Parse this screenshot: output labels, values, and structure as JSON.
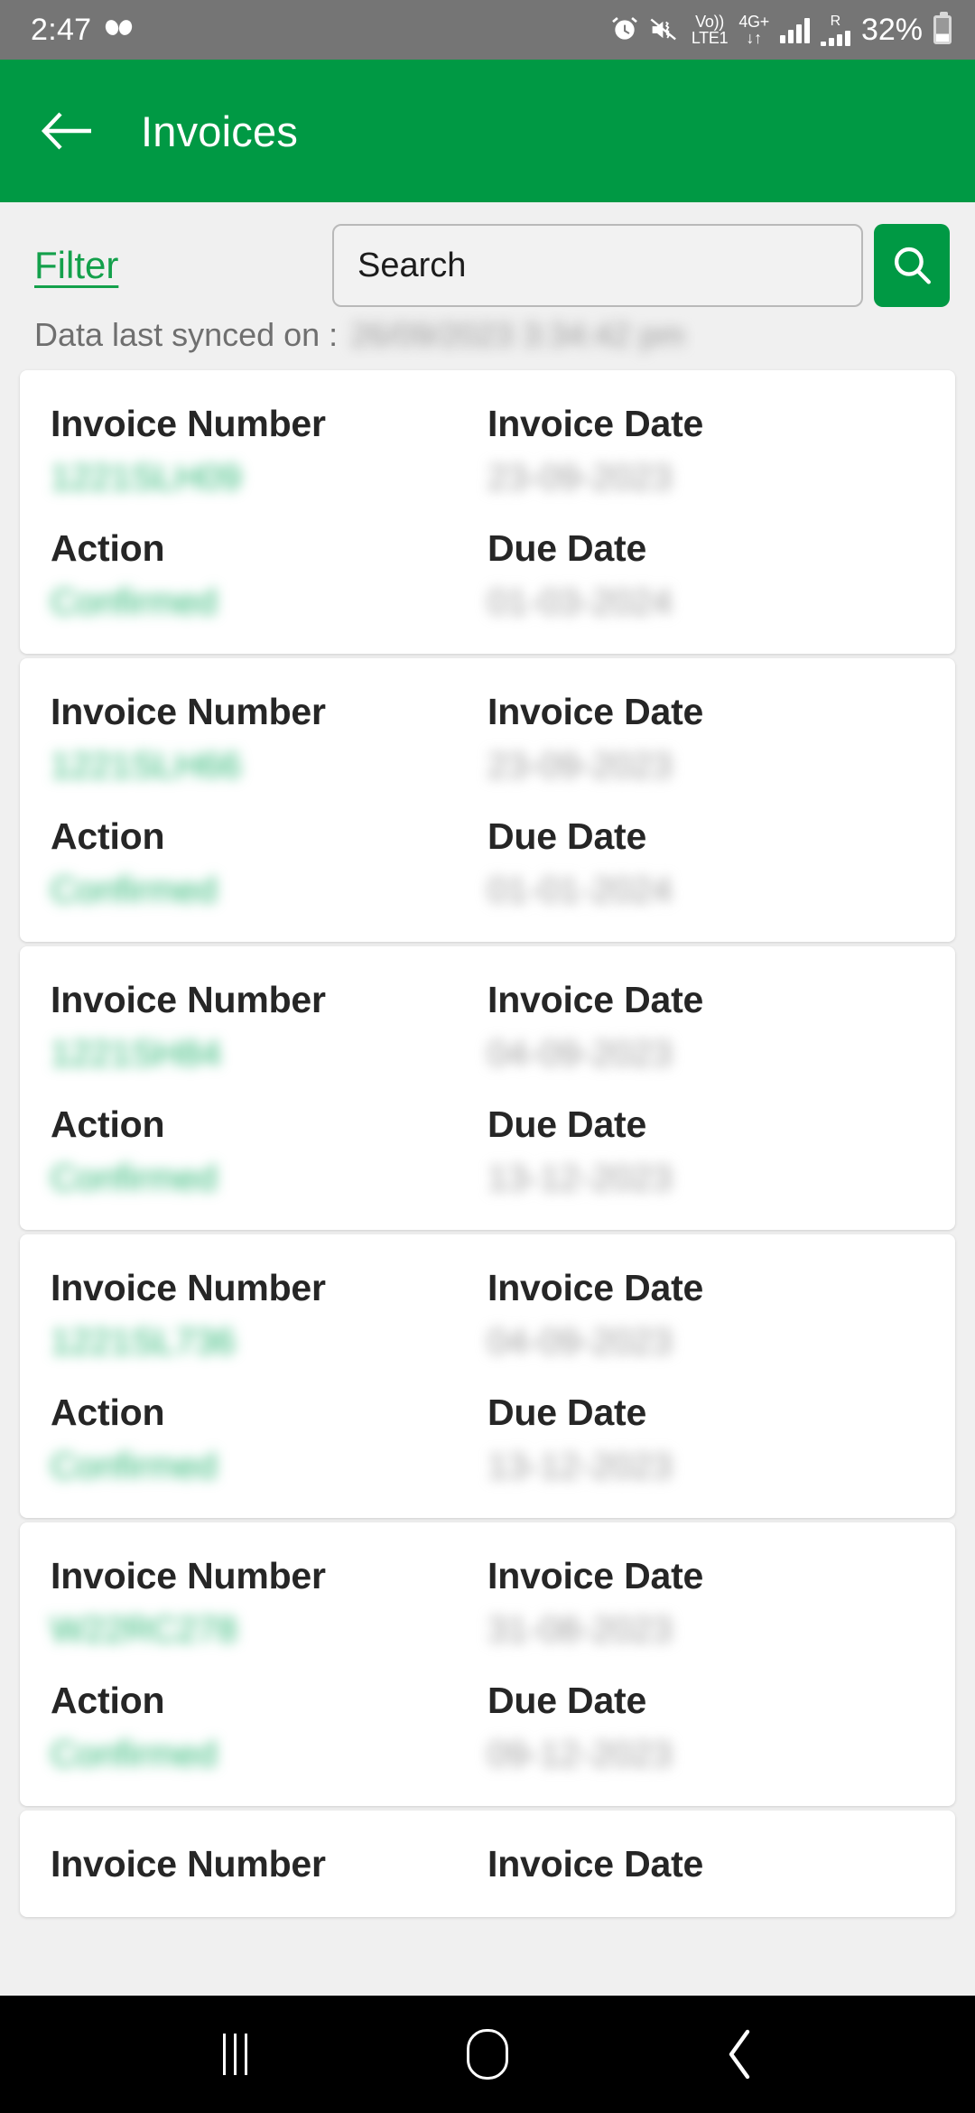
{
  "status_bar": {
    "time": "2:47",
    "app_icon": "clover-icon",
    "icons": [
      "alarm-icon",
      "mute-vibrate-icon",
      "volte-icon",
      "network-4g-plus-icon",
      "signal-bars-icon",
      "roaming-signal-icon"
    ],
    "volte_line1": "Vo))",
    "volte_line2": "LTE1",
    "network_line1": "4G+",
    "network_line2": "↓↑",
    "roaming_label": "R",
    "battery_percent": "32%"
  },
  "app_bar": {
    "back_icon": "back-arrow-icon",
    "title": "Invoices"
  },
  "toolbar": {
    "filter_label": "Filter",
    "search_placeholder": "Search",
    "search_value": "",
    "search_icon": "search-icon"
  },
  "sync": {
    "label": "Data last synced on :",
    "value": "26/09/2023 3:34:42 pm"
  },
  "list": {
    "labels": {
      "invoice_number": "Invoice Number",
      "invoice_date": "Invoice Date",
      "action": "Action",
      "due_date": "Due Date"
    },
    "cards": [
      {
        "invoice_number": "1221SLH09",
        "invoice_date": "23-09-2023",
        "action": "Confirmed",
        "due_date": "01-03-2024"
      },
      {
        "invoice_number": "1221SLH66",
        "invoice_date": "23-09-2023",
        "action": "Confirmed",
        "due_date": "01-01-2024"
      },
      {
        "invoice_number": "1221SH84",
        "invoice_date": "04-09-2023",
        "action": "Confirmed",
        "due_date": "13-12-2023"
      },
      {
        "invoice_number": "1221SL736",
        "invoice_date": "04-09-2023",
        "action": "Confirmed",
        "due_date": "13-12-2023"
      },
      {
        "invoice_number": "W22RC278",
        "invoice_date": "31-08-2023",
        "action": "Confirmed",
        "due_date": "09-12-2023"
      }
    ],
    "partial_card": {
      "invoice_number_label": "Invoice Number",
      "invoice_date_label": "Invoice Date"
    }
  },
  "nav_bar": {
    "recents_icon": "recents-icon",
    "home_icon": "home-icon",
    "back_icon": "nav-back-icon"
  },
  "colors": {
    "brand_green": "#009944",
    "link_green": "#13a04b",
    "value_green": "#2bb673",
    "page_bg": "#f0f0f0",
    "status_bar_bg": "#757575"
  }
}
